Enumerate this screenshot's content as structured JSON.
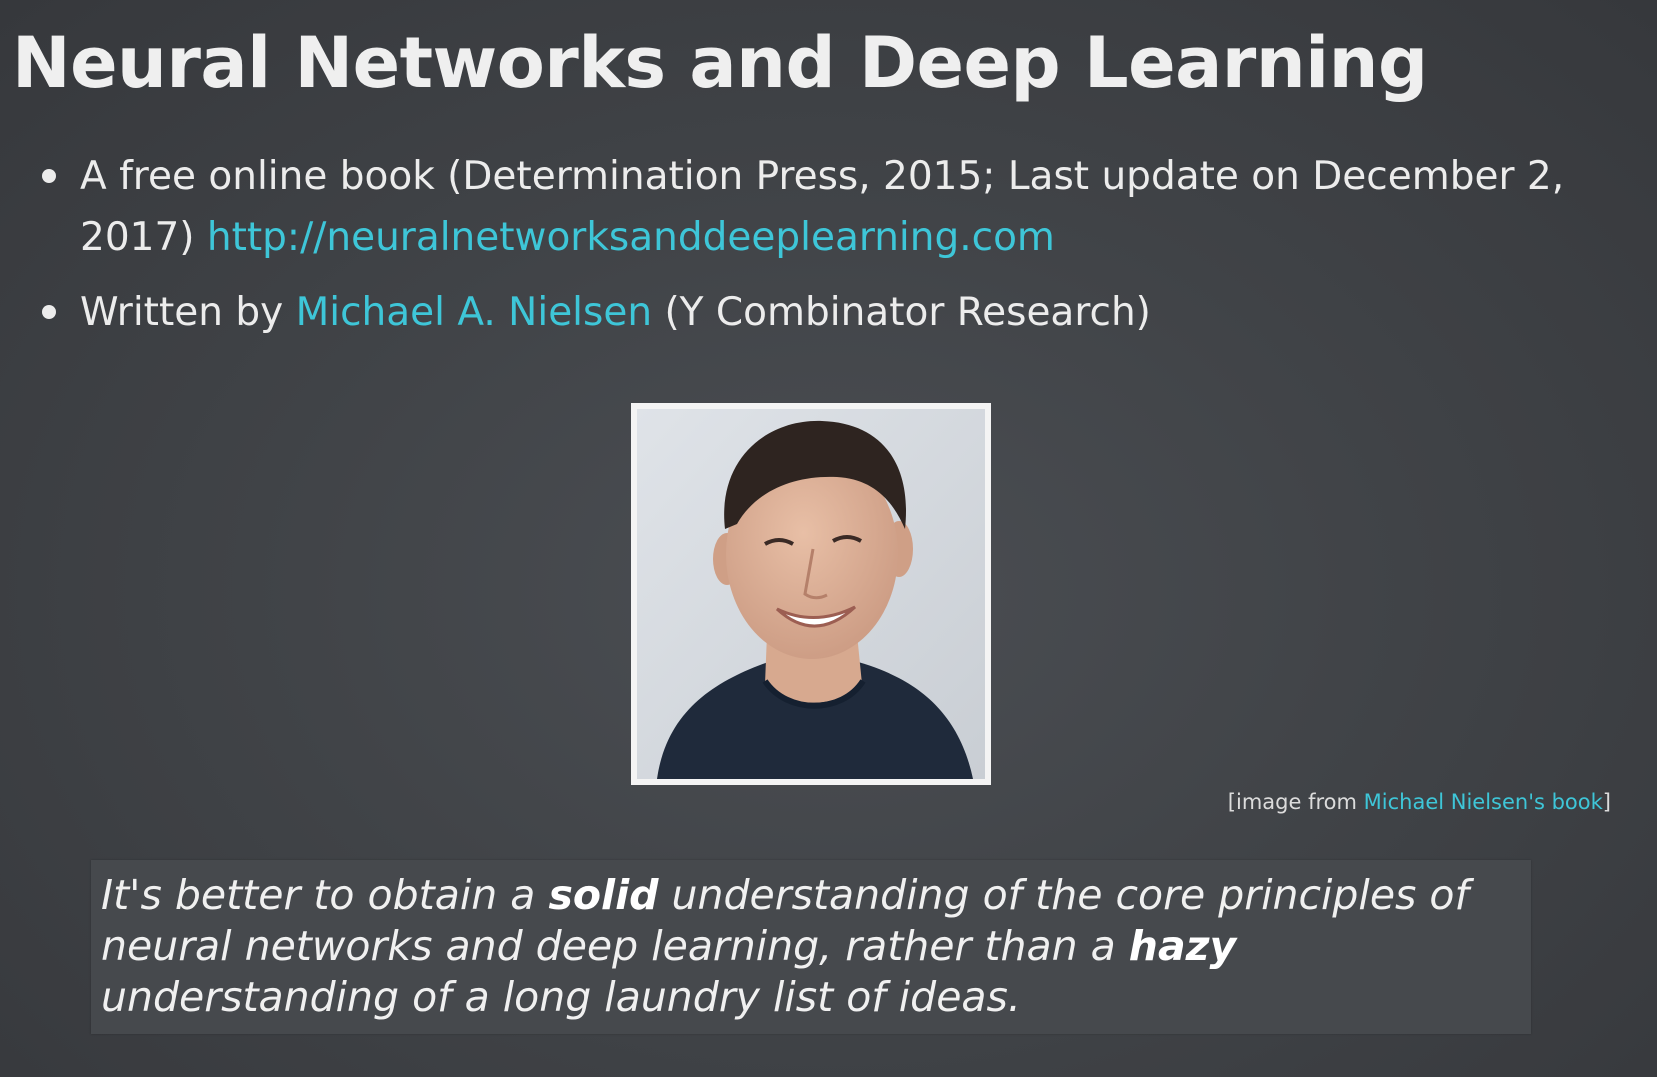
{
  "slide": {
    "title": "Neural Networks and Deep Learning"
  },
  "bullets": [
    {
      "text": "A free online book (Determination Press, 2015; Last update on December 2, 2017)",
      "link_text": "http://neuralnetworksanddeeplearning.com"
    },
    {
      "prefix": "Written by",
      "link_text": "Michael A. Nielsen",
      "suffix": "(Y Combinator Research)"
    }
  ],
  "photo": {
    "subject": "portrait-of-michael-nielsen"
  },
  "caption": {
    "open_bracket": "[",
    "prefix": "image from",
    "link_text": "Michael Nielsen's book",
    "close_bracket": "]"
  },
  "quote": {
    "part1": "It's better to obtain a",
    "bold1": "solid",
    "part2": "understanding of the core principles of neural networks and deep learning, rather than a",
    "bold2": "hazy",
    "part3": "understanding of a long laundry list of ideas."
  },
  "colors": {
    "background": "#414448",
    "text": "#ececec",
    "link": "#3ec6d8",
    "quote_background": "#46494d"
  }
}
